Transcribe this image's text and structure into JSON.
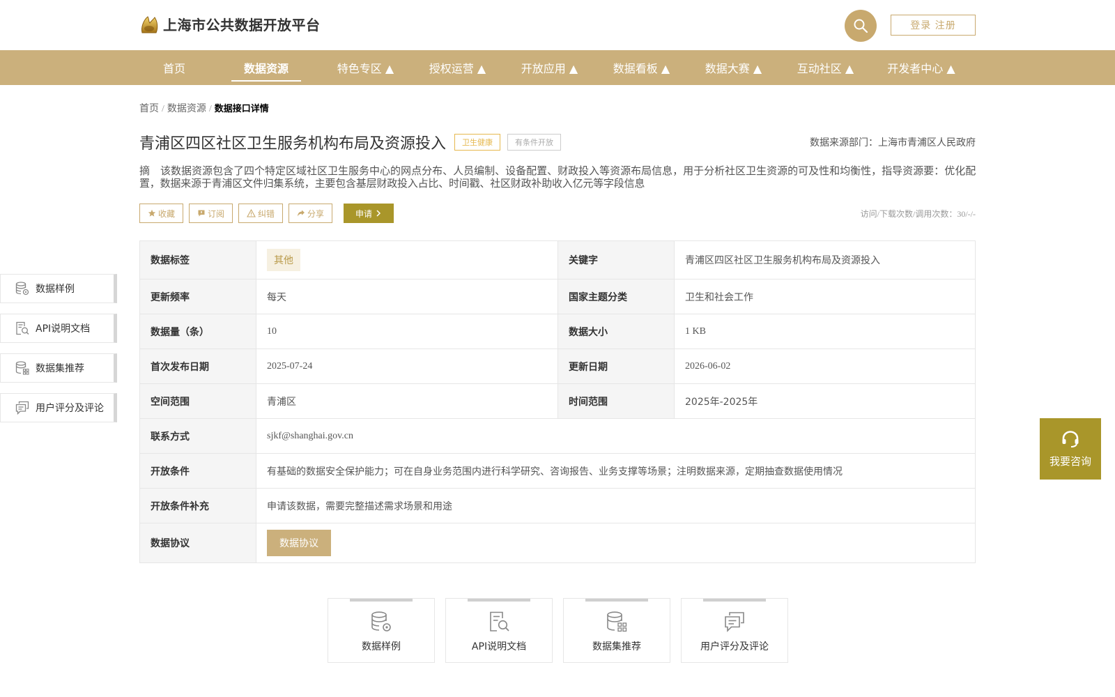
{
  "header": {
    "site_title": "上海市公共数据开放平台",
    "login_label": "登录 注册"
  },
  "nav": {
    "items": [
      {
        "label": "首页"
      },
      {
        "label": "数据资源"
      },
      {
        "label": "特色专区 ▲"
      },
      {
        "label": "授权运营 ▲"
      },
      {
        "label": "开放应用 ▲"
      },
      {
        "label": "数据看板 ▲"
      },
      {
        "label": "数据大赛 ▲"
      },
      {
        "label": "互动社区 ▲"
      },
      {
        "label": "开发者中心 ▲"
      }
    ],
    "active_index": 1
  },
  "breadcrumb": {
    "home": "首页",
    "section": "数据资源",
    "current": "数据接口详情",
    "separator": "/"
  },
  "dataset": {
    "title": "青浦区四区社区卫生服务机构布局及资源投入",
    "tag_category": "卫生健康",
    "tag_access": "有条件开放",
    "source_dept": "数据来源部门：上海市青浦区人民政府",
    "abstract": "摘　该数据资源包含了四个特定区域社区卫生服务中心的网点分布、人员编制、设备配置、财政投入等资源布局信息，用于分析社区卫生资源的可及性和均衡性，指导资源要：优化配置，数据来源于青浦区文件归集系统，主要包含基层财政投入占比、时间戳、社区财政补助收入亿元等字段信息",
    "visit_count": "访问/下载次数/调用次数：30/-/-"
  },
  "actions": {
    "favorite": "收藏",
    "subscribe": "订阅",
    "report": "纠错",
    "share": "分享",
    "apply": "申请"
  },
  "info": {
    "data_tag_label": "数据标签",
    "data_tag_value": "其他",
    "keyword_label": "关键字",
    "keyword_value": "青浦区四区社区卫生服务机构布局及资源投入",
    "frequency_label": "更新频率",
    "frequency_value": "每天",
    "theme_label": "国家主题分类",
    "theme_value": "卫生和社会工作",
    "count_label": "数据量（条）",
    "count_value": "10",
    "size_label": "数据大小",
    "size_value": "1 KB",
    "first_pub_label": "首次发布日期",
    "first_pub_value": "2025-07-24",
    "update_label": "更新日期",
    "update_value": "2026-06-02",
    "space_label": "空间范围",
    "space_value": "青浦区",
    "time_label": "时间范围",
    "time_value": "2025年-2025年",
    "contact_label": "联系方式",
    "contact_value": "sjkf@shanghai.gov.cn",
    "conditions_label": "开放条件",
    "conditions_value": "有基础的数据安全保护能力；可在自身业务范围内进行科学研究、咨询报告、业务支撑等场景；注明数据来源，定期抽查数据使用情况",
    "conditions_extra_label": "开放条件补充",
    "conditions_extra_value": "申请该数据，需要完整描述需求场景和用途",
    "agreement_label": "数据协议",
    "agreement_button": "数据协议"
  },
  "side_nav": {
    "items": [
      {
        "label": "数据样例",
        "icon": "database-gear-icon"
      },
      {
        "label": "API说明文档",
        "icon": "doc-search-icon"
      },
      {
        "label": "数据集推荐",
        "icon": "database-grid-icon"
      },
      {
        "label": "用户评分及评论",
        "icon": "comment-icon"
      }
    ]
  },
  "consult": {
    "label": "我要咨询"
  },
  "cards": {
    "items": [
      {
        "label": "数据样例",
        "icon": "database-gear-icon"
      },
      {
        "label": "API说明文档",
        "icon": "doc-search-icon"
      },
      {
        "label": "数据集推荐",
        "icon": "database-grid-icon"
      },
      {
        "label": "用户评分及评论",
        "icon": "comment-icon"
      }
    ]
  },
  "colors": {
    "brand_gold": "#cbb07c",
    "accent_olive": "#a9962a",
    "tag_gold": "#e6b84e"
  }
}
